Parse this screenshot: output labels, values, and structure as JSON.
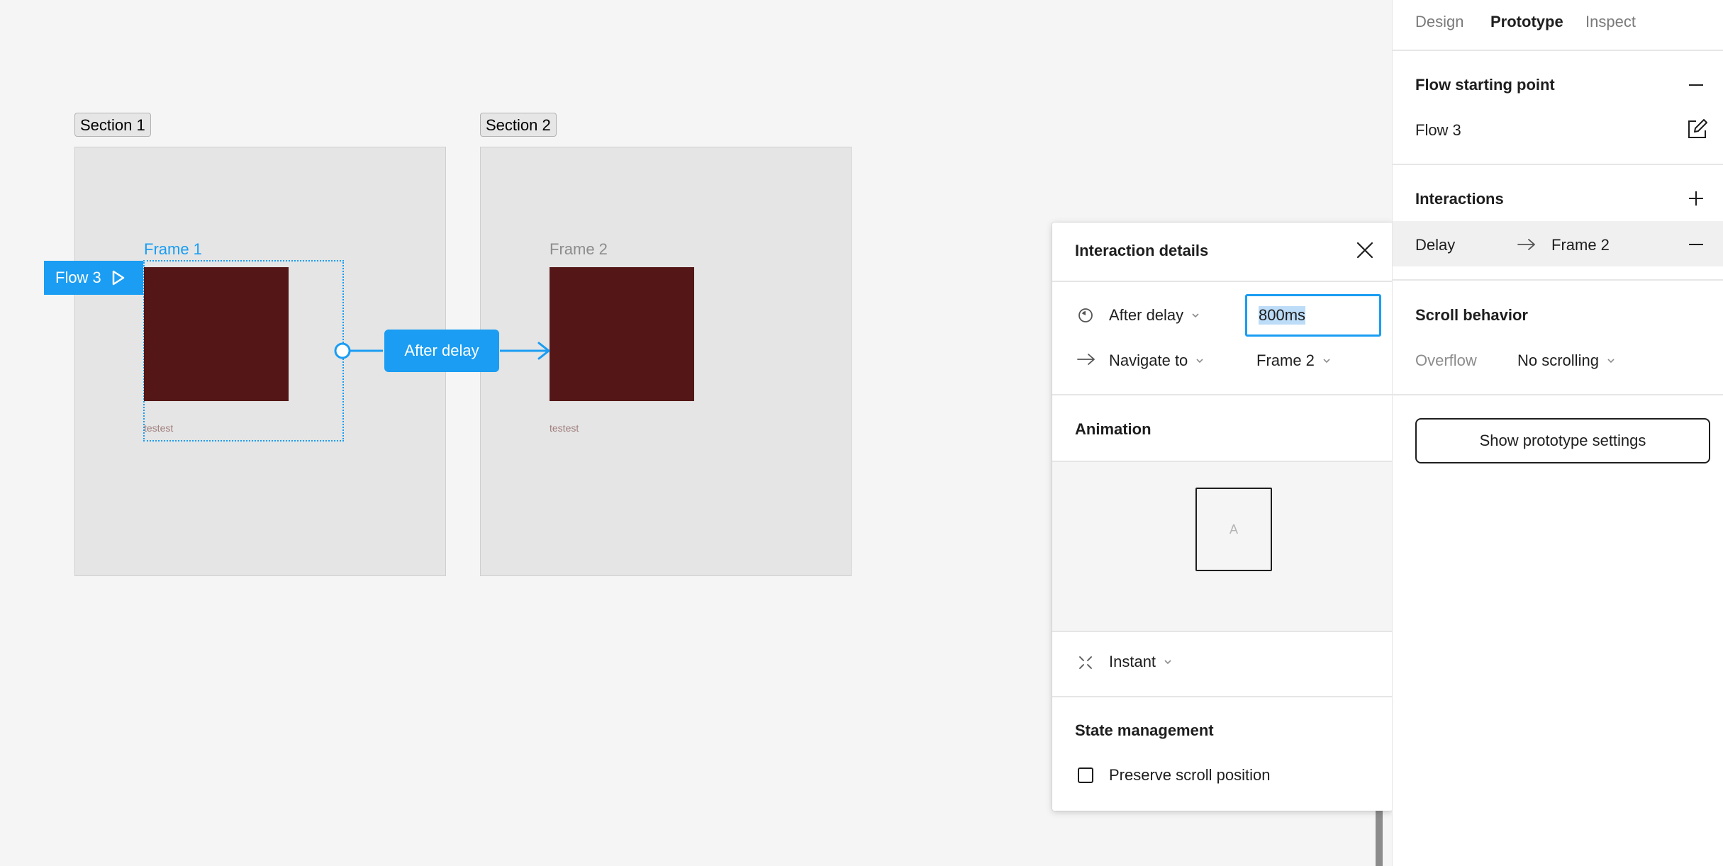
{
  "canvas": {
    "sections": [
      {
        "label": "Section 1"
      },
      {
        "label": "Section 2"
      }
    ],
    "frames": [
      {
        "label": "Frame 1",
        "caption": "testest",
        "selected": true
      },
      {
        "label": "Frame 2",
        "caption": "testest",
        "selected": false
      }
    ],
    "flow_tag": "Flow 3",
    "connector_label": "After delay",
    "colors": {
      "accent": "#1a9df2",
      "frame_fill": "#541617"
    }
  },
  "popup": {
    "title": "Interaction details",
    "trigger": "After delay",
    "delay_value": "800ms",
    "action": "Navigate to",
    "destination": "Frame 2",
    "animation_heading": "Animation",
    "animation_preview_letter": "A",
    "animation_type": "Instant",
    "state_heading": "State management",
    "preserve_scroll_label": "Preserve scroll position",
    "preserve_scroll_checked": false
  },
  "panel": {
    "tabs": [
      {
        "label": "Design"
      },
      {
        "label": "Prototype",
        "active": true
      },
      {
        "label": "Inspect"
      }
    ],
    "flow_start_heading": "Flow starting point",
    "flow_name": "Flow 3",
    "interactions_heading": "Interactions",
    "interaction": {
      "trigger": "Delay",
      "target": "Frame 2"
    },
    "scroll_heading": "Scroll behavior",
    "overflow_label": "Overflow",
    "overflow_value": "No scrolling",
    "settings_button": "Show prototype settings"
  }
}
